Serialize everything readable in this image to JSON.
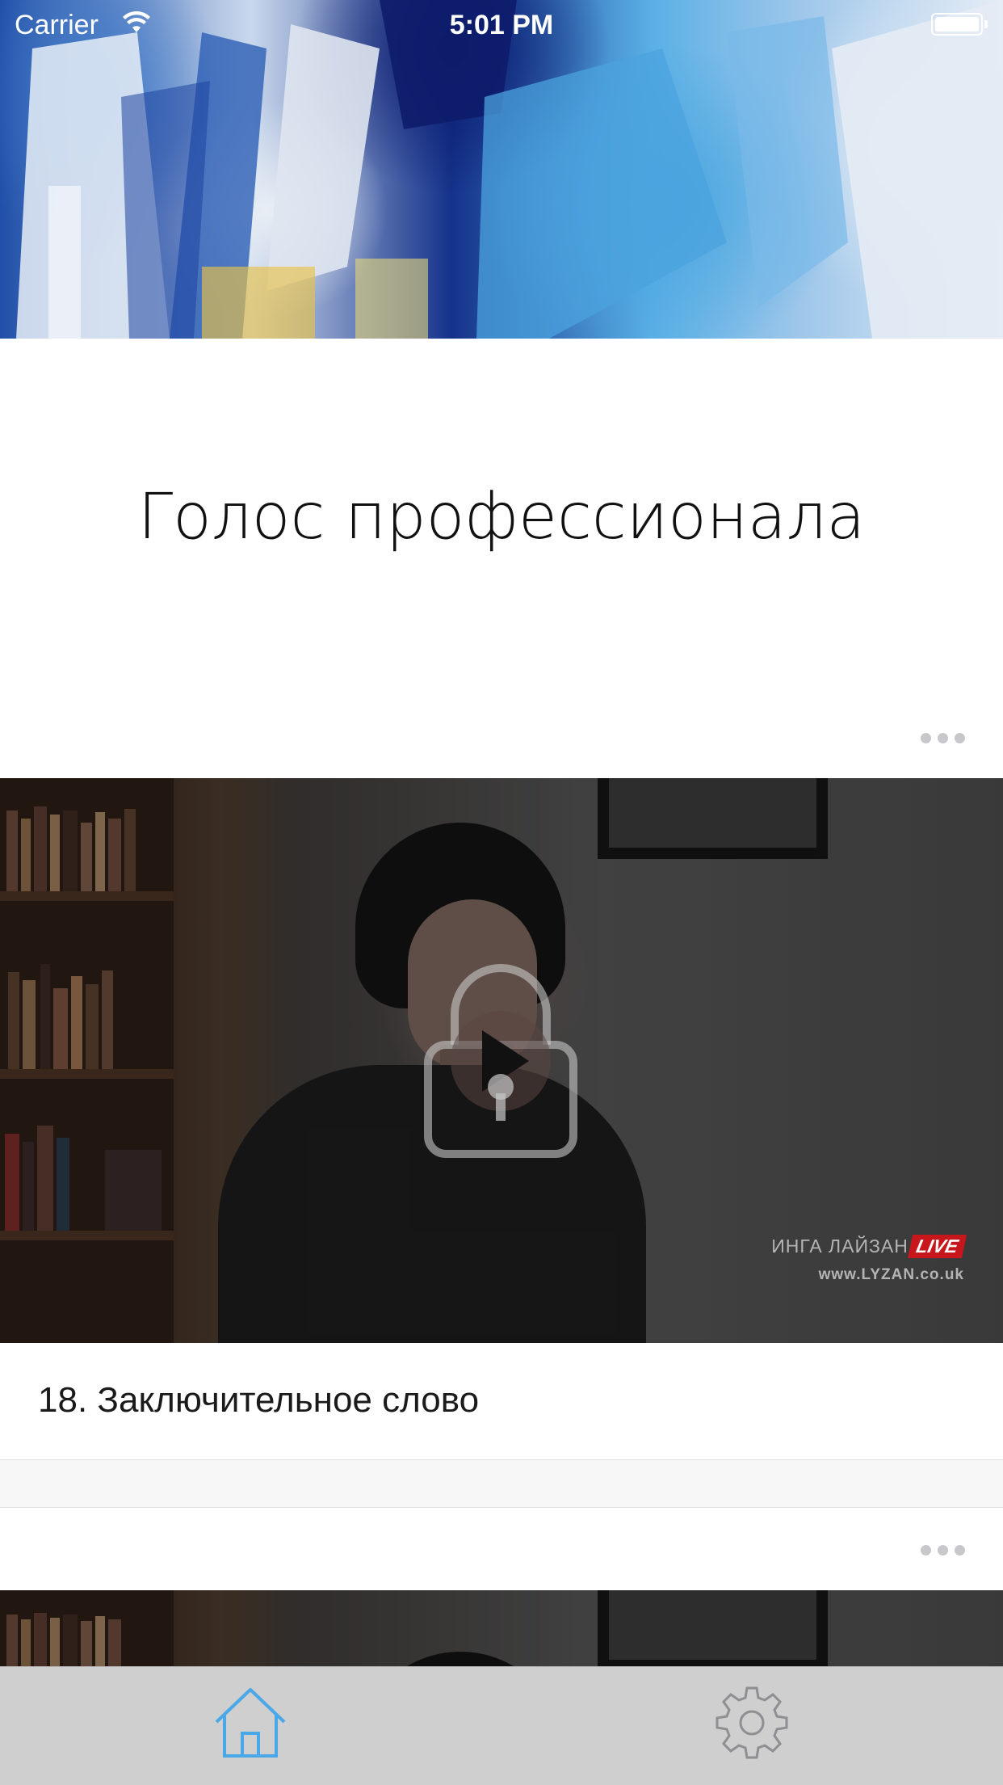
{
  "status_bar": {
    "carrier": "Carrier",
    "time": "5:01 PM"
  },
  "page": {
    "title": "Голос профессионала"
  },
  "cards": [
    {
      "title": "18. Заключительное слово",
      "watermark_name": "ИНГА ЛАЙЗАН",
      "watermark_badge": "LIVE",
      "watermark_url": "www.LYZAN.co.uk",
      "locked": true
    },
    {
      "title": "",
      "locked": true
    }
  ],
  "tab_bar": {
    "items": [
      {
        "icon": "home-icon",
        "selected": true
      },
      {
        "icon": "gear-icon",
        "selected": false
      }
    ],
    "selected_color": "#4aa8e8",
    "unselected_color": "#8e8e93"
  },
  "colors": {
    "more_dots": "#c8c8cc",
    "separator": "#f7f7f7"
  }
}
